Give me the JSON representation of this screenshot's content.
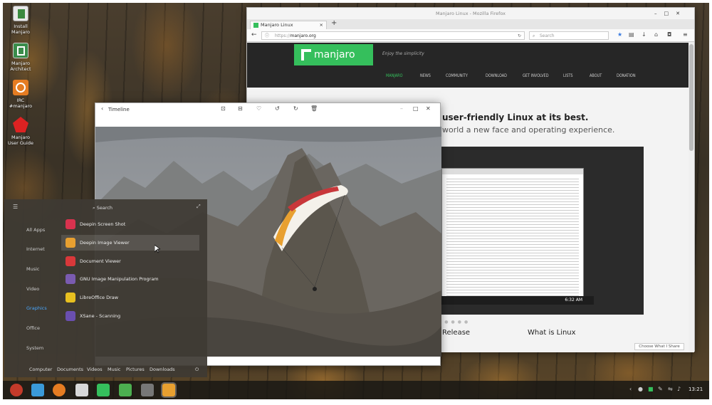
{
  "desktop_icons": [
    {
      "label": "Install\nManjaro",
      "icon": "install-icon",
      "color": "#5a8a4a"
    },
    {
      "label": "Manjaro\nArchitect",
      "icon": "architect-icon",
      "color": "#3a8c4a"
    },
    {
      "label": "IRC\n#manjaro",
      "icon": "irc-icon",
      "color": "#e57c22"
    },
    {
      "label": "Manjaro\nUser Guide",
      "icon": "user-guide-icon",
      "color": "#d22"
    }
  ],
  "firefox": {
    "title": "Manjaro Linux - Mozilla Firefox",
    "tab_label": "Manjaro Linux",
    "url_scheme": "https://",
    "url_host": "manjaro.org",
    "search_placeholder": "Search"
  },
  "site": {
    "logo_text": "manjaro",
    "tagline": "Enjoy the simplicity",
    "menu": [
      "MANJARO",
      "NEWS",
      "COMMUNITY",
      "DOWNLOAD",
      "GET INVOLVED",
      "LISTS",
      "ABOUT",
      "DONATION"
    ],
    "hero_title": "user-friendly Linux at its best.",
    "hero_sub": "world a new face and operating experience.",
    "inner_time": "6:32 AM",
    "section1": "Release",
    "section2": "What is Linux",
    "share_label": "Choose What I Share"
  },
  "viewer": {
    "title": "Timeline"
  },
  "launcher": {
    "search_label": "Search",
    "categories": [
      "All Apps",
      "Internet",
      "Music",
      "Video",
      "Graphics",
      "Office",
      "System"
    ],
    "selected_category": "Graphics",
    "apps": [
      {
        "label": "Deepin Screen Shot",
        "color": "#d8324e"
      },
      {
        "label": "Deepin Image Viewer",
        "color": "#e8a030"
      },
      {
        "label": "Document Viewer",
        "color": "#d9383a"
      },
      {
        "label": "GNU Image Manipulation Program",
        "color": "#7a5bb0"
      },
      {
        "label": "LibreOffice Draw",
        "color": "#e8c020"
      },
      {
        "label": "XSane - Scanning",
        "color": "#6a4fb0"
      }
    ],
    "footer": [
      "Computer",
      "Documents",
      "Videos",
      "Music",
      "Pictures",
      "Downloads"
    ]
  },
  "taskbar": {
    "apps": [
      "#c43a2a",
      "#3a9ad9",
      "#e57c22",
      "#d8d8d8",
      "#35bf5c",
      "#4caf50",
      "#777",
      "#e8a030"
    ],
    "clock": "13:21"
  },
  "colors": {
    "accent": "#35bf5c",
    "selected_blue": "#4aa8ff"
  }
}
